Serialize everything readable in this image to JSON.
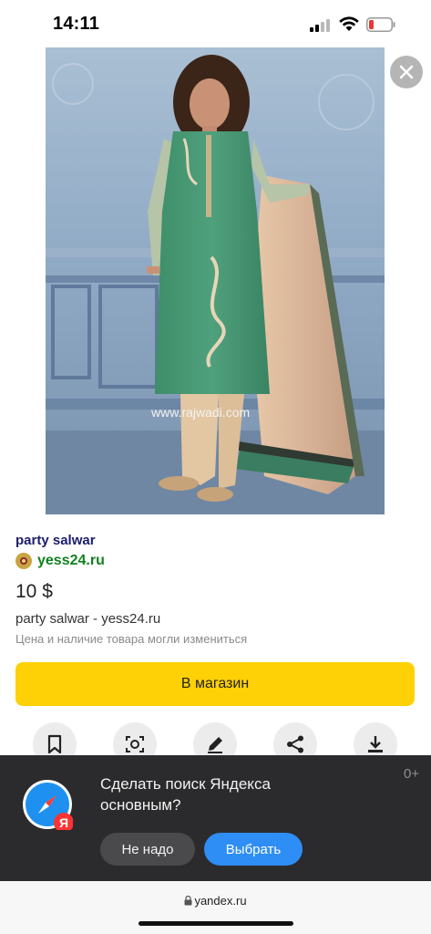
{
  "status_bar": {
    "time": "14:11",
    "battery_color": "#e53935"
  },
  "image": {
    "watermark": "www.rajwadi.com"
  },
  "product": {
    "title": "party salwar",
    "source": "yess24.ru",
    "price": "10 $",
    "subtitle": "party salwar - yess24.ru",
    "disclaimer": "Цена и наличие товара могли измениться"
  },
  "shop_button": {
    "label": "В магазин",
    "color": "#fdd105"
  },
  "actions": [
    {
      "icon": "bookmark-icon"
    },
    {
      "icon": "image-search-icon"
    },
    {
      "icon": "edit-icon"
    },
    {
      "icon": "share-icon"
    },
    {
      "icon": "download-icon"
    }
  ],
  "banner": {
    "text": "Сделать поиск Яндекса основным?",
    "count": "0+",
    "decline_label": "Не надо",
    "accept_label": "Выбрать",
    "accept_color": "#2f8ef5"
  },
  "address_bar": {
    "url": "yandex.ru"
  }
}
